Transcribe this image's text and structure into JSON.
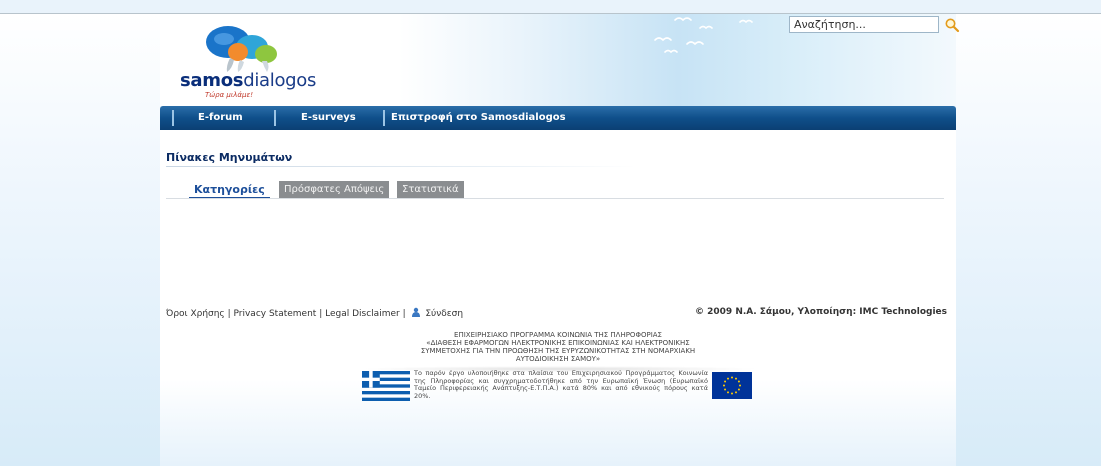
{
  "header": {
    "logo": {
      "brand_bold": "samos",
      "brand_rest": "dialogos",
      "tagline": "Τώρα μιλάμε!"
    },
    "search": {
      "placeholder": "Αναζήτηση..."
    },
    "search_icon": "magnifier-icon"
  },
  "nav": {
    "items": [
      {
        "label": "E-forum"
      },
      {
        "label": "E-surveys"
      },
      {
        "label": "Επιστροφή στο Samosdialogos"
      }
    ]
  },
  "main": {
    "title": "Πίνακες Μηνυμάτων",
    "tabs": [
      {
        "label": "Κατηγορίες",
        "active": true
      },
      {
        "label": "Πρόσφατες Απόψεις",
        "active": false
      },
      {
        "label": "Στατιστικά",
        "active": false
      }
    ]
  },
  "footer": {
    "links": {
      "terms": "Όροι Χρήσης",
      "privacy": "Privacy Statement",
      "disclaimer": "Legal Disclaimer",
      "login": "Σύνδεση",
      "sep": "|"
    },
    "copyright": "© 2009 Ν.Α. Σάμου, Υλοποίηση: IMC Technologies",
    "program_lines": [
      "ΕΠΙΧΕΙΡΗΣΙΑΚΟ ΠΡΟΓΡΑΜΜΑ ΚΟΙΝΩΝΙΑ ΤΗΣ ΠΛΗΡΟΦΟΡΙΑΣ",
      "«ΔΙΑΘΕΣΗ ΕΦΑΡΜΟΓΩΝ ΗΛΕΚΤΡΟΝΙΚΗΣ ΕΠΙΚΟΙΝΩΝΙΑΣ ΚΑΙ ΗΛΕΚΤΡΟΝΙΚΗΣ",
      "ΣΥΜΜΕΤΟΧΗΣ ΓΙΑ ΤΗΝ ΠΡΟΩΘΗΣΗ ΤΗΣ ΕΥΡΥΖΩΝΙΚΟΤΗΤΑΣ ΣΤΗ ΝΟΜΑΡΧΙΑΚΗ",
      "ΑΥΤΟΔΙΟΙΚΗΣΗ ΣΑΜΟΥ»"
    ],
    "funding_text": "Το παρόν έργο υλοποιήθηκε στα πλαίσια του Επιχειρησιακού Προγράμματος Κοινωνία της Πληροφορίας και συγχρηματοδοτήθηκε από την Ευρωπαϊκή Ένωση (Ευρωπαϊκό Ταμείο Περιφερειακής Ανάπτυξης-Ε.Τ.Π.Α.) κατά 80% και από εθνικούς πόρους κατά 20%."
  },
  "colors": {
    "nav_blue": "#0f4f8a",
    "title_blue": "#0b2b63",
    "tab_grey": "#8a8d90",
    "greek_blue": "#0d5eaf",
    "eu_blue": "#003399",
    "eu_gold": "#ffcc00"
  }
}
